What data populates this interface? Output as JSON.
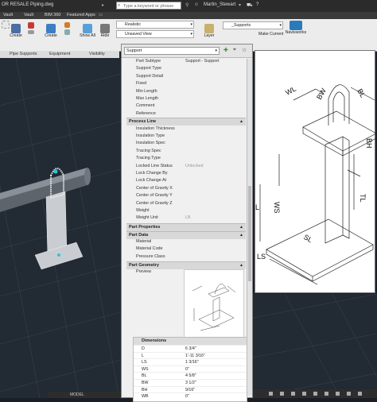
{
  "titlebar": {
    "left_text": "OR RESALE",
    "file_name": "Piping.dwg",
    "search_placeholder": "Type a keyword or phrase",
    "user": "Martin_Stewart"
  },
  "tabs": [
    "Vault",
    "Vault",
    "BIM 360",
    "Featured Apps"
  ],
  "ribbon": {
    "buttons": [
      "Create",
      "Create",
      "Show All",
      "Hide"
    ],
    "panels": [
      "Pipe Supports",
      "Equipment",
      "Visibility"
    ],
    "visual_style": "Realistic",
    "view": "Unsaved View",
    "layer_label": "Layer",
    "layer_dropdown": "_Supports",
    "make_current": "Make Current",
    "navisworks": "Navisworks"
  },
  "palette": {
    "selector": "Support",
    "rows_general": [
      {
        "k": "Part Subtype",
        "v": "Support - Support"
      },
      {
        "k": "Support Type",
        "v": ""
      },
      {
        "k": "Support Detail",
        "v": ""
      },
      {
        "k": "Fixed",
        "v": ""
      },
      {
        "k": "Min Length",
        "v": ""
      },
      {
        "k": "Max Length",
        "v": ""
      },
      {
        "k": "Comment",
        "v": ""
      },
      {
        "k": "Reference",
        "v": ""
      }
    ],
    "process_line_title": "Process Line",
    "rows_process": [
      {
        "k": "Insulation Thickness",
        "v": ""
      },
      {
        "k": "Insulation Type",
        "v": ""
      },
      {
        "k": "Insulation Spec",
        "v": ""
      },
      {
        "k": "Tracing Spec",
        "v": ""
      },
      {
        "k": "Tracing Type",
        "v": ""
      },
      {
        "k": "Locked Line Status",
        "v": "Unlocked"
      },
      {
        "k": "Lock Change By",
        "v": ""
      },
      {
        "k": "Lock Change At",
        "v": ""
      },
      {
        "k": "Center of Gravity X",
        "v": ""
      },
      {
        "k": "Center of Gravity Y",
        "v": ""
      },
      {
        "k": "Center of Gravity Z",
        "v": ""
      },
      {
        "k": "Weight",
        "v": ""
      },
      {
        "k": "Weight Unit",
        "v": "LB"
      }
    ],
    "part_properties_title": "Part Properties",
    "part_data_title": "Part Data",
    "rows_data": [
      {
        "k": "Material",
        "v": ""
      },
      {
        "k": "Material Code",
        "v": ""
      },
      {
        "k": "Pressure Class",
        "v": ""
      }
    ],
    "part_geometry_title": "Part Geometry",
    "preview_label": "Preview",
    "dimensions_title": "Dimensions",
    "dimensions": [
      {
        "k": "D",
        "v": "6 3/4\""
      },
      {
        "k": "L",
        "v": "1'-11 3/16\""
      },
      {
        "k": "LS",
        "v": "1 3/16\""
      },
      {
        "k": "WS",
        "v": "0\""
      },
      {
        "k": "BL",
        "v": "4 5/8\""
      },
      {
        "k": "BW",
        "v": "3 1/2\""
      },
      {
        "k": "BH",
        "v": "9/16\""
      },
      {
        "k": "WB",
        "v": "0\""
      }
    ]
  },
  "diagram_labels": {
    "wl": "WL",
    "bw": "BW",
    "bl": "BL",
    "bh": "BH",
    "tl": "TL",
    "ws": "WS",
    "sl": "SL",
    "ls": "LS",
    "l": "L"
  },
  "status": {
    "model": "MODEL"
  }
}
